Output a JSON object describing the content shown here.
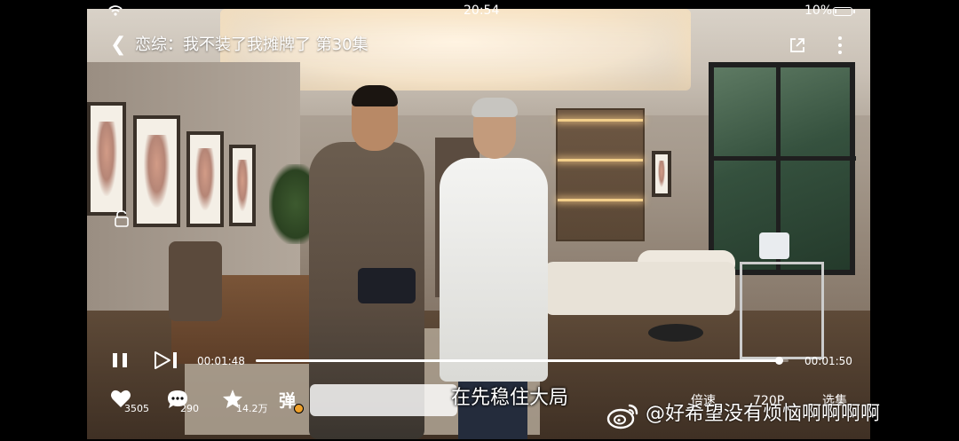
{
  "status_bar": {
    "time": "20:54",
    "battery_percent": "10%",
    "battery_level": 0.1
  },
  "header": {
    "title": "恋综：我不装了我摊牌了 第30集"
  },
  "player": {
    "current_time": "00:01:48",
    "total_time": "00:01:50",
    "progress": 0.982,
    "subtitle": "在先稳住大局"
  },
  "actions": {
    "likes": "3505",
    "comments": "290",
    "favorites": "14.2万",
    "danmu_label": "弹",
    "speed_label": "倍速",
    "quality_label": "720P",
    "episodes_label": "选集"
  },
  "watermark": "@好希望没有烦恼啊啊啊啊",
  "icons": [
    "wifi-icon",
    "battery-icon",
    "back-icon",
    "share-icon",
    "more-icon",
    "lock-icon",
    "pause-icon",
    "next-icon",
    "like-icon",
    "comment-icon",
    "favorite-icon",
    "danmu-icon",
    "weibo-logo-icon"
  ]
}
